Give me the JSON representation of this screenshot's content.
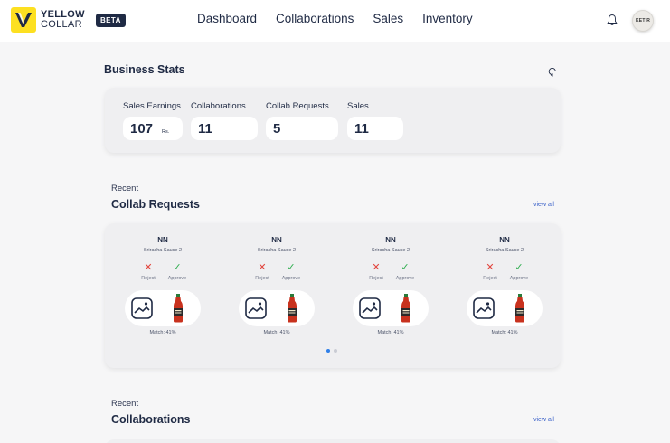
{
  "brand": {
    "name_line1": "YELLOW",
    "name_line2": "COLLAR",
    "badge": "BETA",
    "accent": "#fde021",
    "dark": "#1f2a44"
  },
  "nav": {
    "items": [
      "Dashboard",
      "Collaborations",
      "Sales",
      "Inventory"
    ]
  },
  "header": {
    "avatar_text": "KETIR",
    "bell_icon": "bell-icon"
  },
  "business_stats": {
    "title": "Business Stats",
    "items": [
      {
        "label": "Sales Earnings",
        "value": "107",
        "unit": "Rs."
      },
      {
        "label": "Collaborations",
        "value": "11"
      },
      {
        "label": "Collab Requests",
        "value": "5"
      },
      {
        "label": "Sales",
        "value": "11"
      }
    ]
  },
  "collab_requests": {
    "eyebrow": "Recent",
    "title": "Collab Requests",
    "view_all": "view all",
    "reject_label": "Reject",
    "approve_label": "Approve",
    "cards": [
      {
        "name": "NN",
        "product": "Sriracha Sauce 2",
        "match": "Match: 41%"
      },
      {
        "name": "NN",
        "product": "Sriracha Sauce 2",
        "match": "Match: 41%"
      },
      {
        "name": "NN",
        "product": "Sriracha Sauce 2",
        "match": "Match: 41%"
      },
      {
        "name": "NN",
        "product": "Sriracha Sauce 2",
        "match": "Match: 41%"
      }
    ],
    "pagination": {
      "pages": 2,
      "active": 1
    }
  },
  "collaborations": {
    "eyebrow": "Recent",
    "title": "Collaborations",
    "view_all": "view all"
  }
}
